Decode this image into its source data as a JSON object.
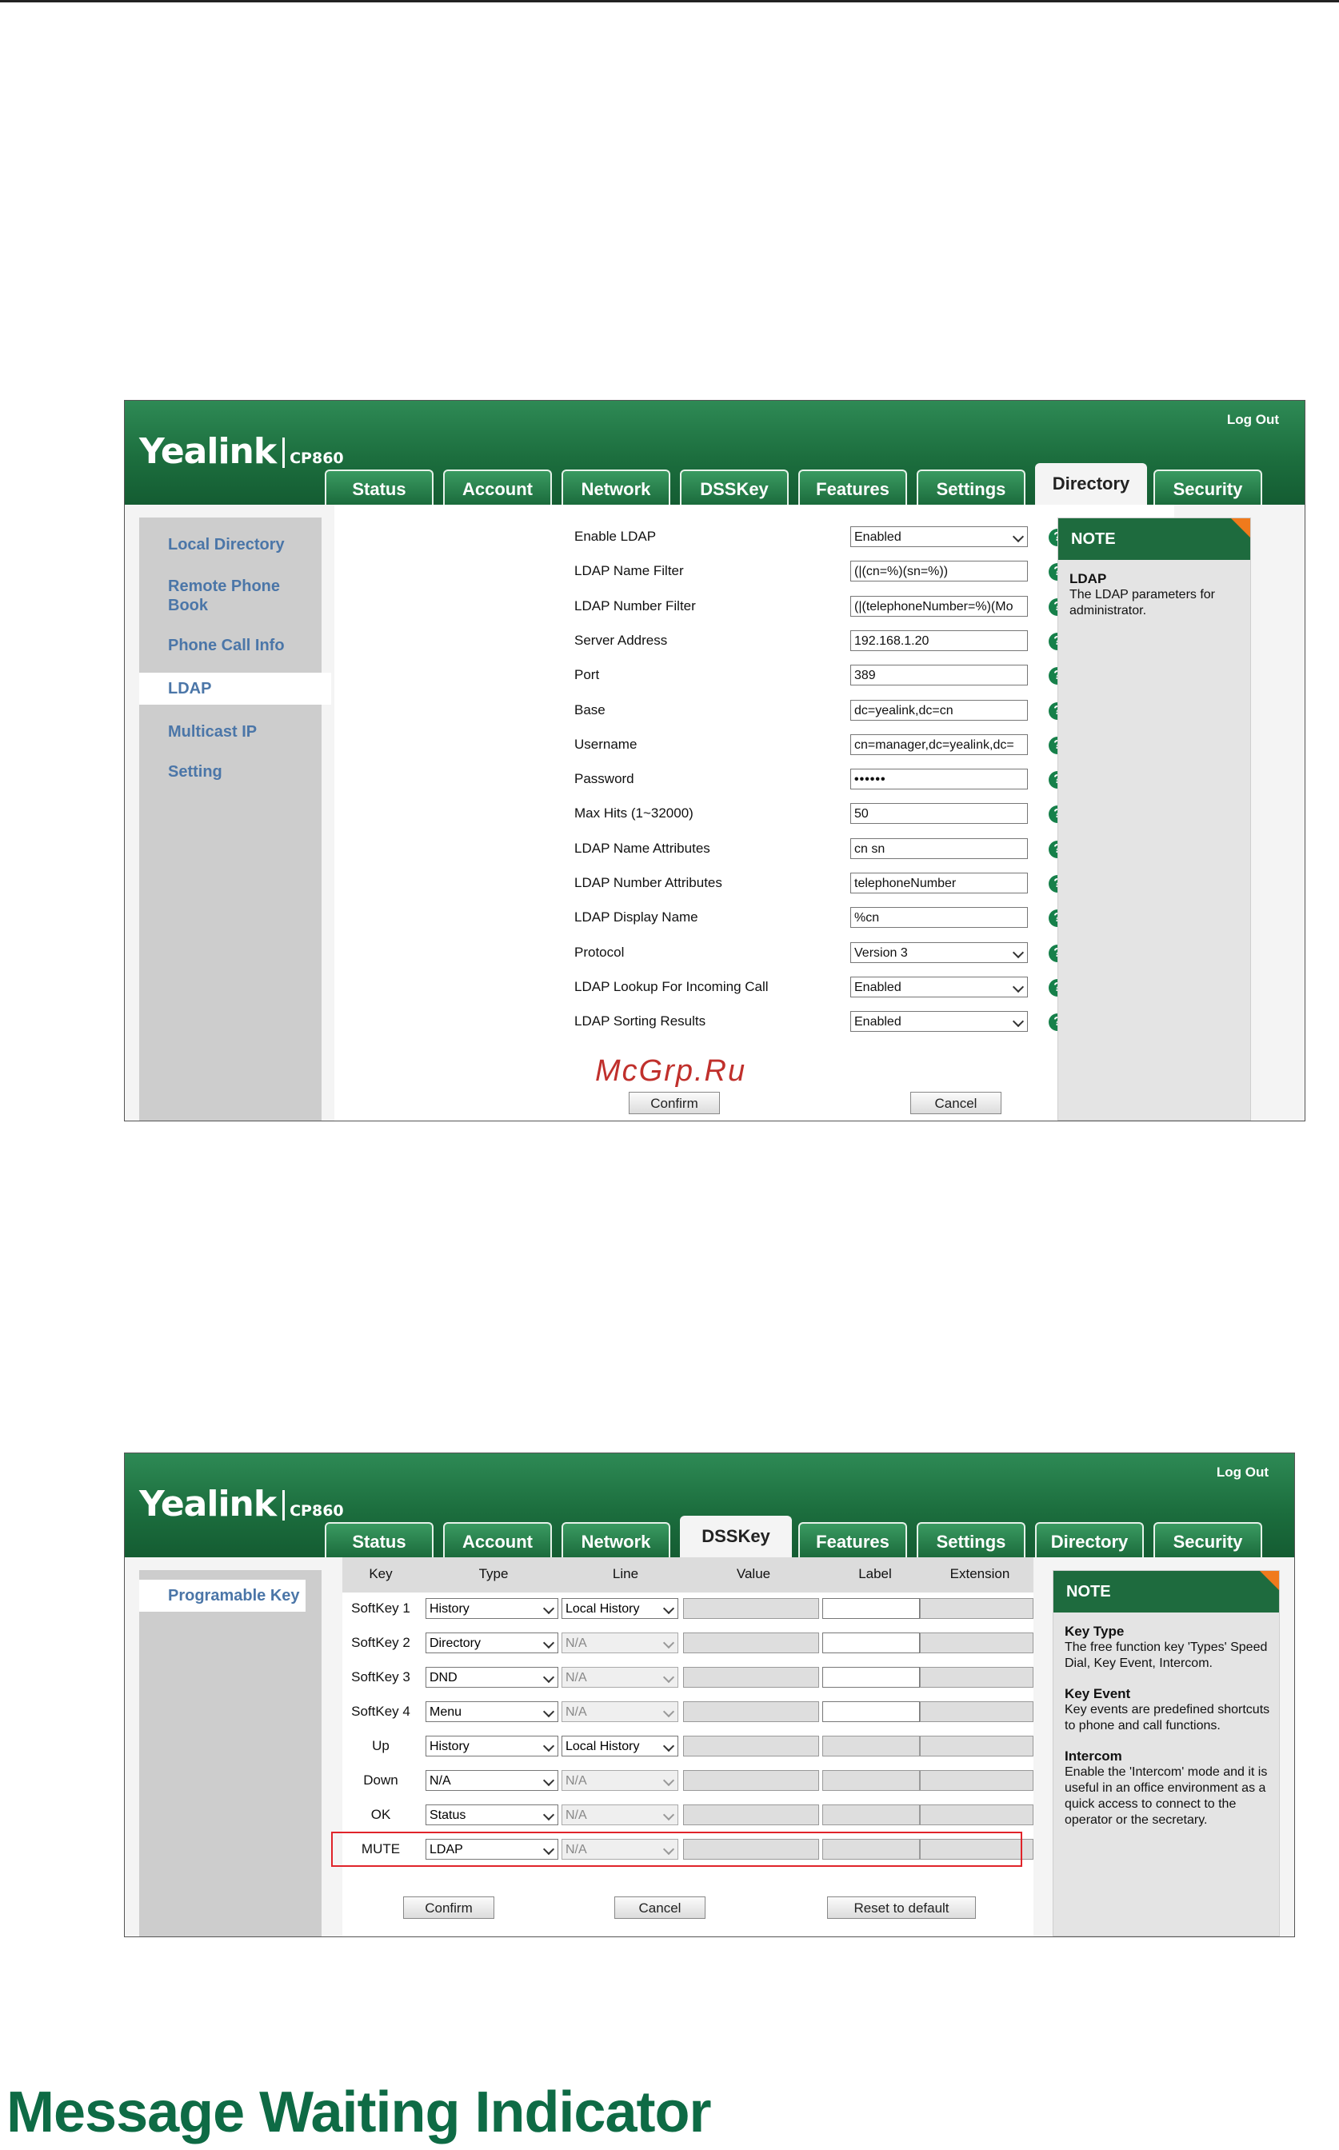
{
  "brand": {
    "logo": "Yealink",
    "model": "CP860",
    "logout": "Log Out"
  },
  "tabs": [
    "Status",
    "Account",
    "Network",
    "DSSKey",
    "Features",
    "Settings",
    "Directory",
    "Security"
  ],
  "ldap_page": {
    "active_tab": "Directory",
    "nav": [
      "Local Directory",
      "Remote Phone Book",
      "Phone Call Info",
      "LDAP",
      "Multicast IP",
      "Setting"
    ],
    "nav_active": "LDAP",
    "fields": [
      {
        "label": "Enable LDAP",
        "value": "Enabled",
        "type": "select"
      },
      {
        "label": "LDAP Name Filter",
        "value": "(|(cn=%)(sn=%))",
        "type": "text"
      },
      {
        "label": "LDAP Number Filter",
        "value": "(|(telephoneNumber=%)(Mo",
        "type": "text"
      },
      {
        "label": "Server Address",
        "value": "192.168.1.20",
        "type": "text"
      },
      {
        "label": "Port",
        "value": "389",
        "type": "text"
      },
      {
        "label": "Base",
        "value": "dc=yealink,dc=cn",
        "type": "text"
      },
      {
        "label": "Username",
        "value": "cn=manager,dc=yealink,dc=",
        "type": "text"
      },
      {
        "label": "Password",
        "value": "••••••",
        "type": "password"
      },
      {
        "label": "Max Hits (1~32000)",
        "value": "50",
        "type": "text"
      },
      {
        "label": "LDAP Name Attributes",
        "value": "cn sn",
        "type": "text"
      },
      {
        "label": "LDAP Number Attributes",
        "value": "telephoneNumber",
        "type": "text"
      },
      {
        "label": "LDAP Display Name",
        "value": "%cn",
        "type": "text"
      },
      {
        "label": "Protocol",
        "value": "Version 3",
        "type": "select"
      },
      {
        "label": "LDAP Lookup For Incoming Call",
        "value": "Enabled",
        "type": "select"
      },
      {
        "label": "LDAP Sorting Results",
        "value": "Enabled",
        "type": "select"
      }
    ],
    "confirm": "Confirm",
    "cancel": "Cancel",
    "note_title": "NOTE",
    "note_heading": "LDAP",
    "note_text": "The LDAP parameters for administrator."
  },
  "watermark": "McGrp.Ru",
  "dss_page": {
    "active_tab": "DSSKey",
    "nav": [
      "Programable Key"
    ],
    "columns": [
      "Key",
      "Type",
      "Line",
      "Value",
      "Label",
      "Extension"
    ],
    "rows": [
      {
        "key": "SoftKey 1",
        "type": "History",
        "line": "Local History",
        "line_enabled": true,
        "label_editable": true
      },
      {
        "key": "SoftKey 2",
        "type": "Directory",
        "line": "N/A",
        "line_enabled": false,
        "label_editable": true
      },
      {
        "key": "SoftKey 3",
        "type": "DND",
        "line": "N/A",
        "line_enabled": false,
        "label_editable": true
      },
      {
        "key": "SoftKey 4",
        "type": "Menu",
        "line": "N/A",
        "line_enabled": false,
        "label_editable": true
      },
      {
        "key": "Up",
        "type": "History",
        "line": "Local History",
        "line_enabled": true,
        "label_editable": false
      },
      {
        "key": "Down",
        "type": "N/A",
        "line": "N/A",
        "line_enabled": false,
        "label_editable": false
      },
      {
        "key": "OK",
        "type": "Status",
        "line": "N/A",
        "line_enabled": false,
        "label_editable": false
      },
      {
        "key": "MUTE",
        "type": "LDAP",
        "line": "N/A",
        "line_enabled": false,
        "label_editable": false
      }
    ],
    "highlighted_row": "MUTE",
    "confirm": "Confirm",
    "cancel": "Cancel",
    "reset": "Reset to default",
    "note_title": "NOTE",
    "notes": [
      {
        "heading": "Key Type",
        "text": "The free function key 'Types' Speed Dial, Key Event, Intercom."
      },
      {
        "heading": "Key Event",
        "text": "Key events are predefined shortcuts to phone and call functions."
      },
      {
        "heading": "Intercom",
        "text": "Enable the 'Intercom' mode and it is useful in an office environment as a quick access to connect to the operator or the secretary."
      }
    ]
  },
  "section_heading": "Message Waiting Indicator",
  "colors": {
    "brand_green": "#1c6e3e",
    "note_accent": "#f07a1c",
    "highlight_red": "#e0242a",
    "heading_green": "#0e6b45"
  }
}
